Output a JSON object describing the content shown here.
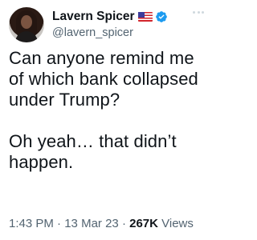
{
  "tweet": {
    "author": {
      "display_name": "Lavern Spicer",
      "handle": "@lavern_spicer",
      "flag_icon": "us-flag-icon",
      "verified_icon": "verified-badge-icon",
      "verified_color": "#1d9bf0"
    },
    "menu_icon": "more-dots-icon",
    "text_paragraph_1": "Can anyone remind me of which bank collapsed under Trump?",
    "text_paragraph_2": "Oh yeah… that didn’t happen.",
    "time": "1:43 PM",
    "separator": "·",
    "date": "13 Mar 23",
    "views_count": "267K",
    "views_label": "Views"
  }
}
